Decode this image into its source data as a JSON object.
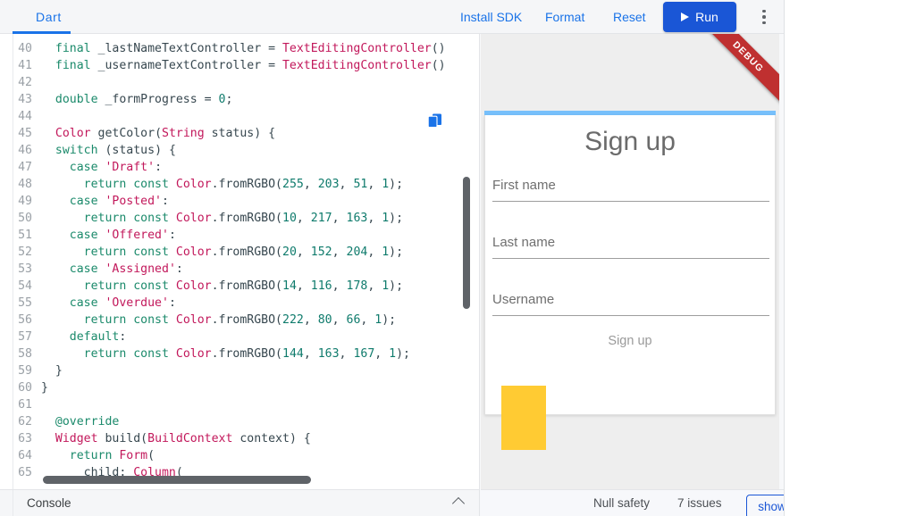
{
  "toolbar": {
    "tab_label": "Dart",
    "install_sdk_label": "Install SDK",
    "format_label": "Format",
    "reset_label": "Reset",
    "run_label": "Run",
    "accent_color": "#1a73e8",
    "run_button_color": "#1a56d6"
  },
  "editor": {
    "language": "Dart",
    "first_line_number": 40,
    "lines": [
      {
        "n": "40",
        "tokens": [
          {
            "t": "  ",
            "c": "pn"
          },
          {
            "t": "final",
            "c": "k"
          },
          {
            "t": " _lastNameTextController ",
            "c": "id"
          },
          {
            "t": "= ",
            "c": "pn"
          },
          {
            "t": "TextEditingController",
            "c": "ty"
          },
          {
            "t": "()",
            "c": "pn"
          }
        ]
      },
      {
        "n": "41",
        "tokens": [
          {
            "t": "  ",
            "c": "pn"
          },
          {
            "t": "final",
            "c": "k"
          },
          {
            "t": " _usernameTextController ",
            "c": "id"
          },
          {
            "t": "= ",
            "c": "pn"
          },
          {
            "t": "TextEditingController",
            "c": "ty"
          },
          {
            "t": "()",
            "c": "pn"
          }
        ]
      },
      {
        "n": "42",
        "tokens": []
      },
      {
        "n": "43",
        "tokens": [
          {
            "t": "  ",
            "c": "pn"
          },
          {
            "t": "double",
            "c": "k"
          },
          {
            "t": " _formProgress ",
            "c": "id"
          },
          {
            "t": "= ",
            "c": "pn"
          },
          {
            "t": "0",
            "c": "num"
          },
          {
            "t": ";",
            "c": "pn"
          }
        ]
      },
      {
        "n": "44",
        "tokens": []
      },
      {
        "n": "45",
        "tokens": [
          {
            "t": "  ",
            "c": "pn"
          },
          {
            "t": "Color",
            "c": "ty"
          },
          {
            "t": " getColor",
            "c": "id"
          },
          {
            "t": "(",
            "c": "pn"
          },
          {
            "t": "String",
            "c": "ty"
          },
          {
            "t": " status",
            "c": "id"
          },
          {
            "t": ") {",
            "c": "pn"
          }
        ]
      },
      {
        "n": "46",
        "tokens": [
          {
            "t": "  ",
            "c": "pn"
          },
          {
            "t": "switch",
            "c": "k"
          },
          {
            "t": " (",
            "c": "pn"
          },
          {
            "t": "status",
            "c": "id"
          },
          {
            "t": ") {",
            "c": "pn"
          }
        ]
      },
      {
        "n": "47",
        "tokens": [
          {
            "t": "    ",
            "c": "pn"
          },
          {
            "t": "case",
            "c": "k"
          },
          {
            "t": " ",
            "c": "pn"
          },
          {
            "t": "'Draft'",
            "c": "str"
          },
          {
            "t": ":",
            "c": "pn"
          }
        ]
      },
      {
        "n": "48",
        "tokens": [
          {
            "t": "      ",
            "c": "pn"
          },
          {
            "t": "return",
            "c": "k"
          },
          {
            "t": " ",
            "c": "pn"
          },
          {
            "t": "const",
            "c": "k"
          },
          {
            "t": " ",
            "c": "pn"
          },
          {
            "t": "Color",
            "c": "ty"
          },
          {
            "t": ".fromRGBO(",
            "c": "pn"
          },
          {
            "t": "255",
            "c": "num"
          },
          {
            "t": ", ",
            "c": "pn"
          },
          {
            "t": "203",
            "c": "num"
          },
          {
            "t": ", ",
            "c": "pn"
          },
          {
            "t": "51",
            "c": "num"
          },
          {
            "t": ", ",
            "c": "pn"
          },
          {
            "t": "1",
            "c": "num"
          },
          {
            "t": ");",
            "c": "pn"
          }
        ]
      },
      {
        "n": "49",
        "tokens": [
          {
            "t": "    ",
            "c": "pn"
          },
          {
            "t": "case",
            "c": "k"
          },
          {
            "t": " ",
            "c": "pn"
          },
          {
            "t": "'Posted'",
            "c": "str"
          },
          {
            "t": ":",
            "c": "pn"
          }
        ]
      },
      {
        "n": "50",
        "tokens": [
          {
            "t": "      ",
            "c": "pn"
          },
          {
            "t": "return",
            "c": "k"
          },
          {
            "t": " ",
            "c": "pn"
          },
          {
            "t": "const",
            "c": "k"
          },
          {
            "t": " ",
            "c": "pn"
          },
          {
            "t": "Color",
            "c": "ty"
          },
          {
            "t": ".fromRGBO(",
            "c": "pn"
          },
          {
            "t": "10",
            "c": "num"
          },
          {
            "t": ", ",
            "c": "pn"
          },
          {
            "t": "217",
            "c": "num"
          },
          {
            "t": ", ",
            "c": "pn"
          },
          {
            "t": "163",
            "c": "num"
          },
          {
            "t": ", ",
            "c": "pn"
          },
          {
            "t": "1",
            "c": "num"
          },
          {
            "t": ");",
            "c": "pn"
          }
        ]
      },
      {
        "n": "51",
        "tokens": [
          {
            "t": "    ",
            "c": "pn"
          },
          {
            "t": "case",
            "c": "k"
          },
          {
            "t": " ",
            "c": "pn"
          },
          {
            "t": "'Offered'",
            "c": "str"
          },
          {
            "t": ":",
            "c": "pn"
          }
        ]
      },
      {
        "n": "52",
        "tokens": [
          {
            "t": "      ",
            "c": "pn"
          },
          {
            "t": "return",
            "c": "k"
          },
          {
            "t": " ",
            "c": "pn"
          },
          {
            "t": "const",
            "c": "k"
          },
          {
            "t": " ",
            "c": "pn"
          },
          {
            "t": "Color",
            "c": "ty"
          },
          {
            "t": ".fromRGBO(",
            "c": "pn"
          },
          {
            "t": "20",
            "c": "num"
          },
          {
            "t": ", ",
            "c": "pn"
          },
          {
            "t": "152",
            "c": "num"
          },
          {
            "t": ", ",
            "c": "pn"
          },
          {
            "t": "204",
            "c": "num"
          },
          {
            "t": ", ",
            "c": "pn"
          },
          {
            "t": "1",
            "c": "num"
          },
          {
            "t": ");",
            "c": "pn"
          }
        ]
      },
      {
        "n": "53",
        "tokens": [
          {
            "t": "    ",
            "c": "pn"
          },
          {
            "t": "case",
            "c": "k"
          },
          {
            "t": " ",
            "c": "pn"
          },
          {
            "t": "'Assigned'",
            "c": "str"
          },
          {
            "t": ":",
            "c": "pn"
          }
        ]
      },
      {
        "n": "54",
        "tokens": [
          {
            "t": "      ",
            "c": "pn"
          },
          {
            "t": "return",
            "c": "k"
          },
          {
            "t": " ",
            "c": "pn"
          },
          {
            "t": "const",
            "c": "k"
          },
          {
            "t": " ",
            "c": "pn"
          },
          {
            "t": "Color",
            "c": "ty"
          },
          {
            "t": ".fromRGBO(",
            "c": "pn"
          },
          {
            "t": "14",
            "c": "num"
          },
          {
            "t": ", ",
            "c": "pn"
          },
          {
            "t": "116",
            "c": "num"
          },
          {
            "t": ", ",
            "c": "pn"
          },
          {
            "t": "178",
            "c": "num"
          },
          {
            "t": ", ",
            "c": "pn"
          },
          {
            "t": "1",
            "c": "num"
          },
          {
            "t": ");",
            "c": "pn"
          }
        ]
      },
      {
        "n": "55",
        "tokens": [
          {
            "t": "    ",
            "c": "pn"
          },
          {
            "t": "case",
            "c": "k"
          },
          {
            "t": " ",
            "c": "pn"
          },
          {
            "t": "'Overdue'",
            "c": "str"
          },
          {
            "t": ":",
            "c": "pn"
          }
        ]
      },
      {
        "n": "56",
        "tokens": [
          {
            "t": "      ",
            "c": "pn"
          },
          {
            "t": "return",
            "c": "k"
          },
          {
            "t": " ",
            "c": "pn"
          },
          {
            "t": "const",
            "c": "k"
          },
          {
            "t": " ",
            "c": "pn"
          },
          {
            "t": "Color",
            "c": "ty"
          },
          {
            "t": ".fromRGBO(",
            "c": "pn"
          },
          {
            "t": "222",
            "c": "num"
          },
          {
            "t": ", ",
            "c": "pn"
          },
          {
            "t": "80",
            "c": "num"
          },
          {
            "t": ", ",
            "c": "pn"
          },
          {
            "t": "66",
            "c": "num"
          },
          {
            "t": ", ",
            "c": "pn"
          },
          {
            "t": "1",
            "c": "num"
          },
          {
            "t": ");",
            "c": "pn"
          }
        ]
      },
      {
        "n": "57",
        "tokens": [
          {
            "t": "    ",
            "c": "pn"
          },
          {
            "t": "default",
            "c": "k"
          },
          {
            "t": ":",
            "c": "pn"
          }
        ]
      },
      {
        "n": "58",
        "tokens": [
          {
            "t": "      ",
            "c": "pn"
          },
          {
            "t": "return",
            "c": "k"
          },
          {
            "t": " ",
            "c": "pn"
          },
          {
            "t": "const",
            "c": "k"
          },
          {
            "t": " ",
            "c": "pn"
          },
          {
            "t": "Color",
            "c": "ty"
          },
          {
            "t": ".fromRGBO(",
            "c": "pn"
          },
          {
            "t": "144",
            "c": "num"
          },
          {
            "t": ", ",
            "c": "pn"
          },
          {
            "t": "163",
            "c": "num"
          },
          {
            "t": ", ",
            "c": "pn"
          },
          {
            "t": "167",
            "c": "num"
          },
          {
            "t": ", ",
            "c": "pn"
          },
          {
            "t": "1",
            "c": "num"
          },
          {
            "t": ");",
            "c": "pn"
          }
        ]
      },
      {
        "n": "59",
        "tokens": [
          {
            "t": "  }",
            "c": "pn"
          }
        ]
      },
      {
        "n": "60",
        "tokens": [
          {
            "t": "}",
            "c": "pn"
          }
        ]
      },
      {
        "n": "61",
        "tokens": []
      },
      {
        "n": "62",
        "tokens": [
          {
            "t": "  ",
            "c": "pn"
          },
          {
            "t": "@override",
            "c": "an"
          }
        ]
      },
      {
        "n": "63",
        "tokens": [
          {
            "t": "  ",
            "c": "pn"
          },
          {
            "t": "Widget",
            "c": "ty"
          },
          {
            "t": " build",
            "c": "id"
          },
          {
            "t": "(",
            "c": "pn"
          },
          {
            "t": "BuildContext",
            "c": "ty"
          },
          {
            "t": " context",
            "c": "id"
          },
          {
            "t": ") {",
            "c": "pn"
          }
        ]
      },
      {
        "n": "64",
        "tokens": [
          {
            "t": "    ",
            "c": "pn"
          },
          {
            "t": "return",
            "c": "k"
          },
          {
            "t": " ",
            "c": "pn"
          },
          {
            "t": "Form",
            "c": "ty"
          },
          {
            "t": "(",
            "c": "pn"
          }
        ]
      },
      {
        "n": "65",
        "tokens": [
          {
            "t": "      child",
            "c": "id"
          },
          {
            "t": ": ",
            "c": "pn"
          },
          {
            "t": "Column",
            "c": "ty"
          },
          {
            "t": "(",
            "c": "pn"
          }
        ]
      }
    ]
  },
  "console": {
    "label": "Console",
    "collapse_icon": "chevron-up-icon"
  },
  "preview": {
    "debug_banner": "DEBUG",
    "debug_banner_color": "#bf3030",
    "progress_bar_color": "#77c0fb",
    "card_title": "Sign up",
    "fields": [
      {
        "label": "First name",
        "value": ""
      },
      {
        "label": "Last name",
        "value": ""
      },
      {
        "label": "Username",
        "value": ""
      }
    ],
    "submit_label": "Sign up",
    "swatch_color": "#ffcb33"
  },
  "statusbar": {
    "null_safety_label": "Null safety",
    "issues_label": "7 issues",
    "show_label": "show"
  }
}
